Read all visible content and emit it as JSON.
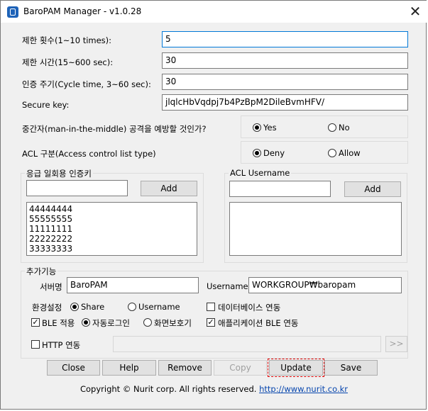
{
  "window": {
    "title": "BaroPAM Manager - v1.0.28",
    "close_glyph": "✕"
  },
  "fields": {
    "limit_count": {
      "label": "제한 횟수(1~10 times):",
      "value": "5"
    },
    "limit_time": {
      "label": "제한 시간(15~600 sec):",
      "value": "30"
    },
    "cycle_time": {
      "label": "인증 주기(Cycle time, 3~60 sec):",
      "value": "30"
    },
    "secure_key": {
      "label": "Secure key:",
      "value": "jlqlcHbVqdpj7b4PzBpM2DileBvmHFV/"
    }
  },
  "mitm": {
    "label": "중간자(man-in-the-middle) 공격을 예방할 것인가?",
    "yes": "Yes",
    "no": "No",
    "selected": "Yes"
  },
  "acl": {
    "label": "ACL 구분(Access control list type)",
    "deny": "Deny",
    "allow": "Allow",
    "selected": "Deny"
  },
  "emergency": {
    "title": "응급 일회용 인증키",
    "input": "",
    "add": "Add",
    "items": [
      "44444444",
      "55555555",
      "11111111",
      "22222222",
      "33333333"
    ]
  },
  "acl_user": {
    "title": "ACL Username",
    "input": "",
    "add": "Add",
    "items": []
  },
  "extra": {
    "title": "추가기능",
    "server_label": "서버명",
    "server_value": "BaroPAM",
    "username_label": "Username",
    "username_value": "WORKGROUP₩baropam",
    "env_label": "환경설정",
    "env_share": "Share",
    "env_username": "Username",
    "env_selected": "Share",
    "db_link": "데이터베이스 연동",
    "ble": "BLE 적용",
    "autologin": "자동로그인",
    "screensaver": "화면보호기",
    "app_ble": "애플리케이션 BLE 연동",
    "http": "HTTP 연동",
    "http_value": "",
    "go": ">>"
  },
  "buttons": {
    "close": "Close",
    "help": "Help",
    "remove": "Remove",
    "copy": "Copy",
    "update": "Update",
    "save": "Save"
  },
  "footer": {
    "copyright": "Copyright © Nurit corp. All rights reserved.",
    "link": "http://www.nurit.co.kr"
  }
}
